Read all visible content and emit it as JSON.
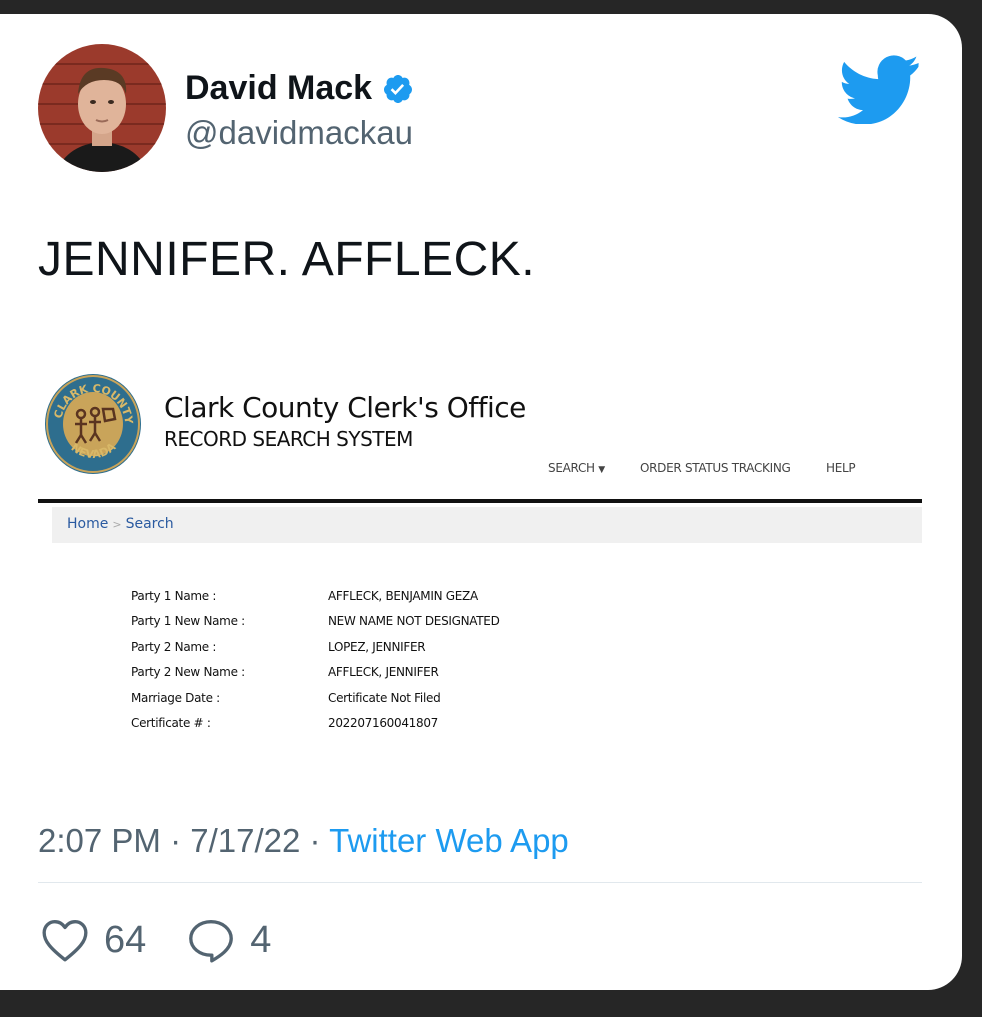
{
  "user": {
    "display_name": "David Mack",
    "handle": "@davidmackau",
    "verified": true
  },
  "tweet": {
    "text": "JENNIFER. AFFLECK."
  },
  "attachment": {
    "office_title": "Clark County Clerk's Office",
    "system_title": "RECORD SEARCH SYSTEM",
    "seal_text_top": "CLARK COUNTY",
    "seal_text_bottom": "NEVADA",
    "nav": {
      "search": "SEARCH",
      "order_status": "ORDER STATUS TRACKING",
      "help": "HELP"
    },
    "breadcrumb": {
      "home": "Home",
      "separator": ">",
      "current": "Search"
    },
    "record": [
      {
        "label": "Party 1 Name :",
        "value": "AFFLECK, BENJAMIN GEZA"
      },
      {
        "label": "Party 1 New Name :",
        "value": "NEW NAME NOT DESIGNATED"
      },
      {
        "label": "Party 2 Name :",
        "value": "LOPEZ, JENNIFER"
      },
      {
        "label": "Party 2 New Name :",
        "value": "AFFLECK, JENNIFER"
      },
      {
        "label": "Marriage Date :",
        "value": "Certificate Not Filed"
      },
      {
        "label": "Certificate # :",
        "value": "202207160041807"
      }
    ]
  },
  "meta": {
    "time": "2:07 PM",
    "separator": "·",
    "date": "7/17/22",
    "source": "Twitter Web App"
  },
  "actions": {
    "likes": "64",
    "replies": "4"
  },
  "icons": {
    "verified": "verified-badge-icon",
    "brand": "twitter-bird-icon",
    "like": "heart-icon",
    "reply": "speech-bubble-icon",
    "dropdown": "caret-down-icon"
  },
  "colors": {
    "twitter_blue": "#1d9bf0",
    "text": "#0f1419",
    "secondary": "#536471",
    "link_blue": "#2a5aa0"
  }
}
